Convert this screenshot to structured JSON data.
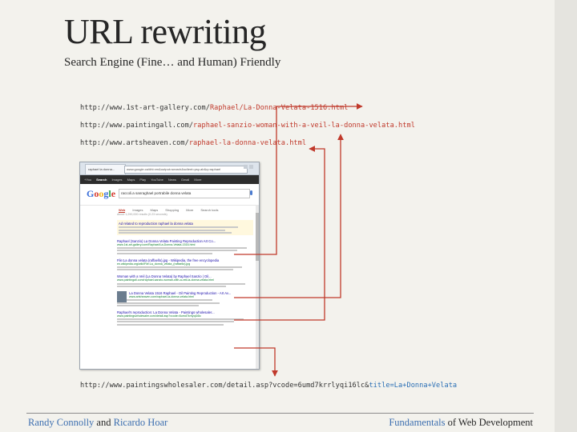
{
  "slide": {
    "title": "URL rewriting",
    "subtitle": "Search Engine (Fine… and Human) Friendly"
  },
  "urls": [
    {
      "base": "http://www.1st-art-gallery.com/",
      "path": "Raphael/La-Donna-Velata-1516.html"
    },
    {
      "base": "http://www.paintingall.com/",
      "path": "raphael-sanzio-woman-with-a-veil-la-donna-velata.html"
    },
    {
      "base": "http://www.artsheaven.com/",
      "path": "raphael-la-donna-velata.html"
    },
    {
      "base": "http://www.paintingswholesaler.com/detail.asp?vcode=6umd7krrlyqi16lc&",
      "path": "title=La+Donna+Velata"
    }
  ],
  "browser": {
    "tab_label": "raphael la donna...",
    "address": "www.google.ca/#hl=en&output=search&sclient=psy-ab&q=raphael",
    "google_nav": [
      "+You",
      "Search",
      "Images",
      "Maps",
      "Play",
      "YouTube",
      "News",
      "Gmail",
      "More"
    ],
    "logo": "Google",
    "query": "raccoli.a sanraghael portrabile donna velata",
    "search_tabs": [
      "Web",
      "Images",
      "Maps",
      "Shopping",
      "More",
      "Search tools"
    ],
    "stats": "About 1,290,000 results (0.23 seconds)",
    "ad_title": "Ad related to reproduction raphael la donna velata",
    "results": [
      {
        "title": "Raphael (Sanzio) La Donna Velata Painting Reproduction Art Co...",
        "url": "www.1st-art-gallery.com/Raphael/La-Donna-Velata-1516.html"
      },
      {
        "title": "File:La donna velata (raffaello).jpg - Wikipedia, the free encyclopedia",
        "url": "en.wikipedia.org/wiki/File:La_donna_velata_(raffaello).jpg"
      },
      {
        "title": "Woman with a Veil (La Donna Velata) by Raphael Sanzio | Oil...",
        "url": "www.paintingall.com/raphael-sanzio-woman-with-a-veil-la-donna-velata.html"
      },
      {
        "title": "La Donna Velata 1516 Raphael - Oil Painting Reproduction - Art Av...",
        "url": "www.artsheaven.com/raphael-la-donna-velata.html"
      },
      {
        "title": "Raphael's reproduction: La Donna Velata - Paintings wholesaler...",
        "url": "www.paintingswholesaler.com/detail.asp?vcode=6umd7krrlyqi16lc"
      }
    ]
  },
  "footer": {
    "author1": "Randy Connolly",
    "and": "and",
    "author2": "Ricardo Hoar",
    "book_part1": "Fundamentals",
    "book_part2": "of Web Development"
  }
}
